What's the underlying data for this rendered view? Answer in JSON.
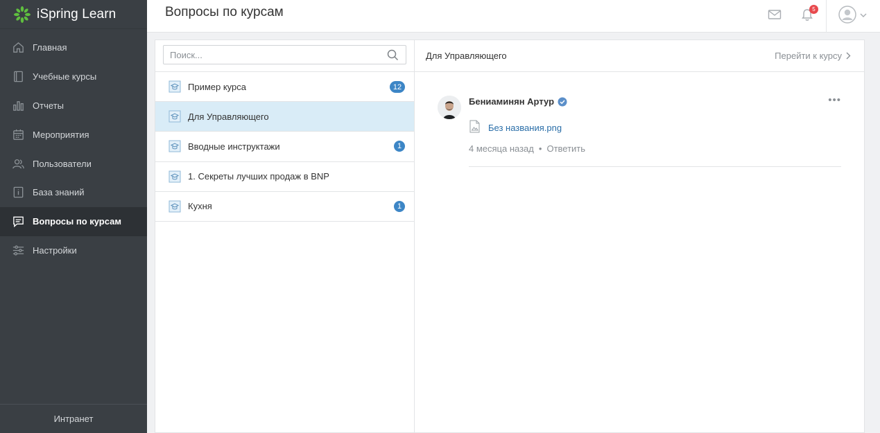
{
  "app": {
    "name": "iSpring Learn",
    "logo_icon": "ispring-logo-icon"
  },
  "sidebar": {
    "items": [
      {
        "label": "Главная",
        "icon": "home-icon",
        "active": false
      },
      {
        "label": "Учебные курсы",
        "icon": "book-icon",
        "active": false
      },
      {
        "label": "Отчеты",
        "icon": "bar-chart-icon",
        "active": false
      },
      {
        "label": "Мероприятия",
        "icon": "calendar-icon",
        "active": false
      },
      {
        "label": "Пользователи",
        "icon": "users-icon",
        "active": false
      },
      {
        "label": "База знаний",
        "icon": "knowledge-base-icon",
        "active": false
      },
      {
        "label": "Вопросы по курсам",
        "icon": "questions-icon",
        "active": true
      },
      {
        "label": "Настройки",
        "icon": "settings-sliders-icon",
        "active": false
      }
    ],
    "footer_label": "Интранет"
  },
  "header": {
    "title": "Вопросы по курсам",
    "notifications_count": "5"
  },
  "search": {
    "placeholder": "Поиск...",
    "value": ""
  },
  "courses": [
    {
      "title": "Пример курса",
      "count": "12",
      "selected": false
    },
    {
      "title": "Для Управляющего",
      "count": "",
      "selected": true
    },
    {
      "title": "Вводные инструктажи",
      "count": "1",
      "selected": false
    },
    {
      "title": "1. Секреты лучших продаж в BNP",
      "count": "",
      "selected": false
    },
    {
      "title": "Кухня",
      "count": "1",
      "selected": false
    }
  ],
  "detail": {
    "course_title": "Для Управляющего",
    "goto_label": "Перейти к курсу",
    "comment": {
      "author": "Бениаминян Артур",
      "file_name": "Без названия.png",
      "time": "4 месяца назад",
      "separator": "•",
      "reply_label": "Ответить",
      "more": "•••"
    }
  },
  "colors": {
    "sidebar_bg": "#3a3f44",
    "accent_blue": "#3d86c6",
    "selected_row": "#d9ecf7",
    "logo_green": "#5fbf3f",
    "badge_red": "#e8494d"
  }
}
